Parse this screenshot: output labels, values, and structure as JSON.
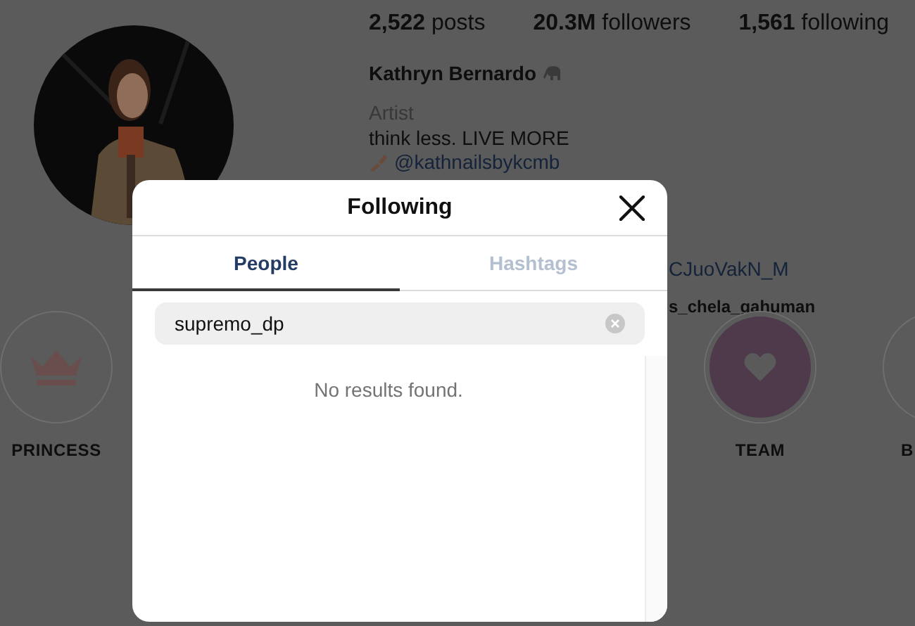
{
  "profile": {
    "stats": [
      "**2,522** posts",
      "**20.3M** followers",
      "**1,561** following"
    ],
    "name": "Kathryn Bernardo",
    "category": "Artist",
    "bio": "think less. LIVE MORE",
    "link": "@kathnailsbykcmb",
    "extra_lines": [
      {
        "kind": "link",
        "text": "CJuoVakN_M"
      },
      {
        "kind": "mention",
        "text": "s_chela_gahuman"
      }
    ]
  },
  "highlights": [
    {
      "kind": "crown",
      "label": "PRINCESS"
    },
    {
      "kind": "heart",
      "label": "TEAM"
    },
    {
      "kind": "plain",
      "label": "B"
    }
  ],
  "dialog": {
    "title": "Following",
    "tabs": [
      {
        "label": "People",
        "selected": true
      },
      {
        "label": "Hashtags",
        "selected": false
      }
    ],
    "search": {
      "value": "supremo_dp"
    },
    "message": "No results found."
  }
}
